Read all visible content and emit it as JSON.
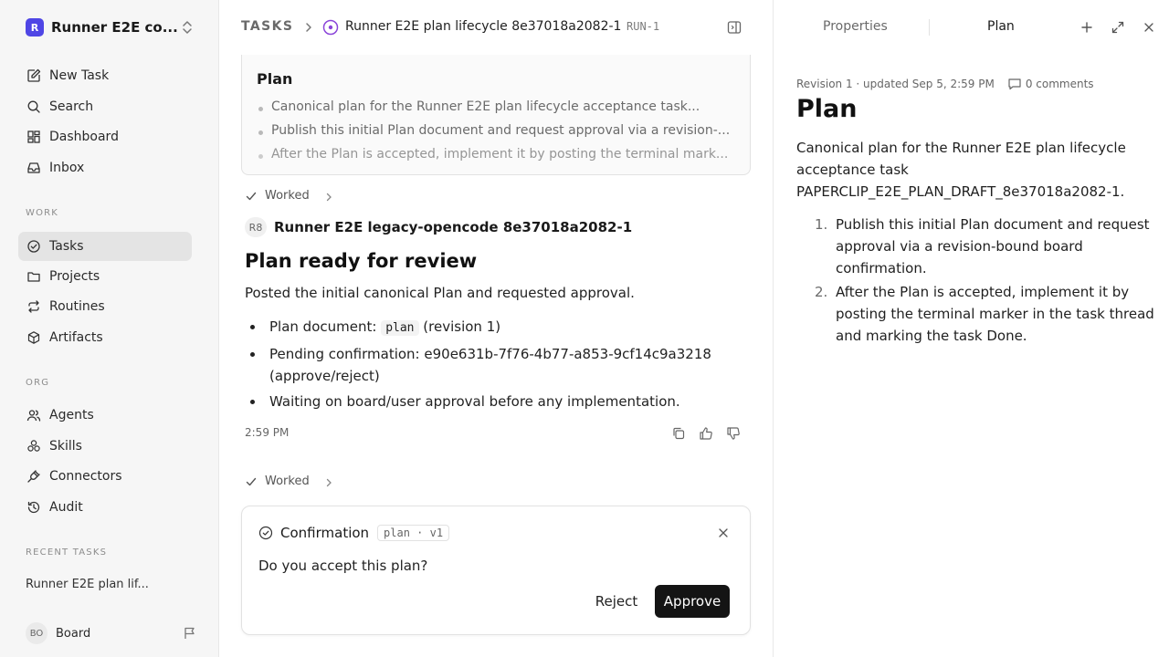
{
  "workspace": {
    "logo_letter": "R",
    "name": "Runner E2E co..."
  },
  "sidebar": {
    "top_items": [
      {
        "label": "New Task"
      },
      {
        "label": "Search"
      },
      {
        "label": "Dashboard"
      },
      {
        "label": "Inbox"
      }
    ],
    "work_label": "WORK",
    "work_items": [
      {
        "label": "Tasks"
      },
      {
        "label": "Projects"
      },
      {
        "label": "Routines"
      },
      {
        "label": "Artifacts"
      }
    ],
    "org_label": "ORG",
    "org_items": [
      {
        "label": "Agents"
      },
      {
        "label": "Skills"
      },
      {
        "label": "Connectors"
      },
      {
        "label": "Audit"
      }
    ],
    "recent_label": "RECENT TASKS",
    "recent_item": "Runner E2E plan lif...",
    "board": {
      "initials": "BO",
      "label": "Board"
    }
  },
  "breadcrumb": {
    "root": "TASKS",
    "title": "Runner E2E plan lifecycle 8e37018a2082-1",
    "id": "RUN-1"
  },
  "plan_card": {
    "title": "Plan",
    "items": [
      "Canonical plan for the Runner E2E plan lifecycle acceptance task...",
      "Publish this initial Plan document and request approval via a revision-...",
      "After the Plan is accepted, implement it by posting the terminal mark..."
    ]
  },
  "worked_label": "Worked",
  "message": {
    "author_initials": "R8",
    "author_name": "Runner E2E legacy-opencode 8e37018a2082-1",
    "title": "Plan ready for review",
    "intro": "Posted the initial canonical Plan and requested approval.",
    "bullet1_prefix": "Plan document:",
    "bullet1_code": "plan",
    "bullet1_suffix": "(revision 1)",
    "bullet2": "Pending confirmation: e90e631b-7f76-4b77-a853-9cf14c9a3218 (approve/reject)",
    "bullet3": "Waiting on board/user approval before any implementation.",
    "time": "2:59 PM"
  },
  "confirmation": {
    "title": "Confirmation",
    "tag": "plan · v1",
    "question": "Do you accept this plan?",
    "reject_label": "Reject",
    "approve_label": "Approve"
  },
  "right_panel": {
    "tab_properties": "Properties",
    "tab_plan": "Plan",
    "revision_text": "Revision 1 · updated Sep 5, 2:59 PM",
    "comments_text": "0 comments",
    "title": "Plan",
    "paragraph": "Canonical plan for the Runner E2E plan lifecycle acceptance task PAPERCLIP_E2E_PLAN_DRAFT_8e37018a2082-1.",
    "steps": [
      {
        "num": "1.",
        "text": "Publish this initial Plan document and request approval via a revision-bound board confirmation."
      },
      {
        "num": "2.",
        "text": "After the Plan is accepted, implement it by posting the terminal marker in the task thread and marking the task Done."
      }
    ]
  },
  "colors": {
    "accent": "#4f46e5",
    "approve_bg": "#141414",
    "active_nav_bg": "#e4e4e4"
  }
}
